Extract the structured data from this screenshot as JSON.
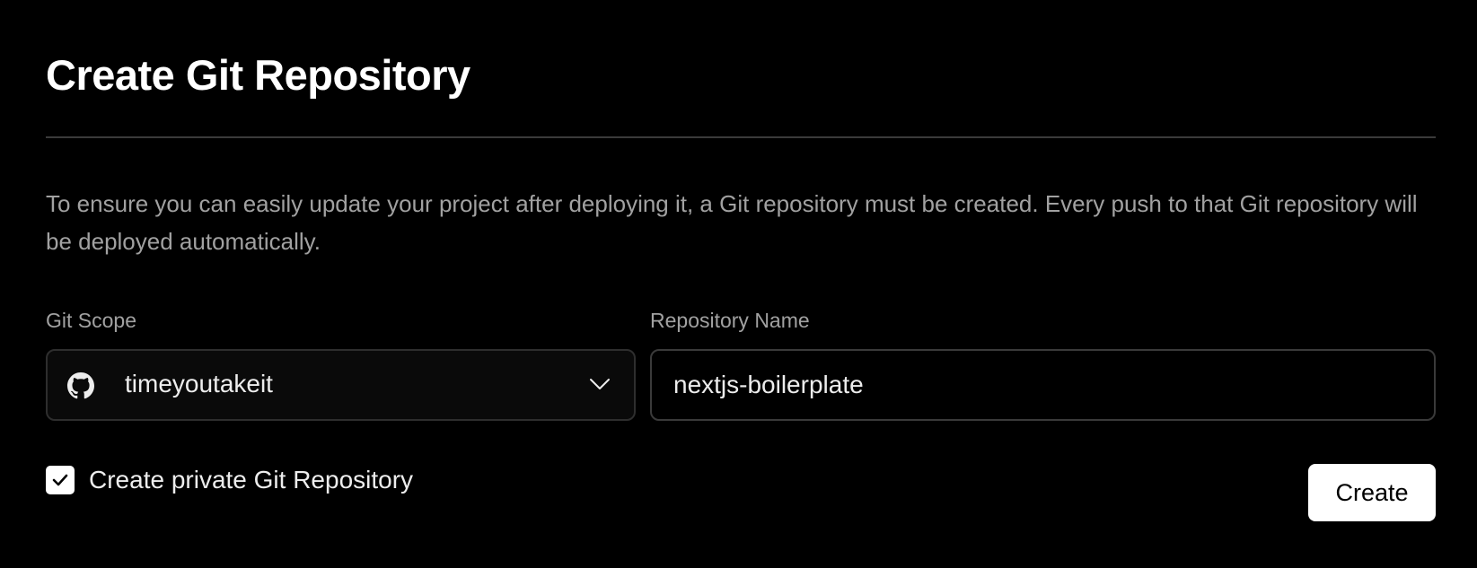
{
  "title": "Create Git Repository",
  "description": "To ensure you can easily update your project after deploying it, a Git repository must be created. Every push to that Git repository will be deployed automatically.",
  "git_scope": {
    "label": "Git Scope",
    "value": "timeyoutakeit",
    "icon": "github-icon",
    "dropdown_icon": "chevron-down-icon"
  },
  "repository_name": {
    "label": "Repository Name",
    "value": "nextjs-boilerplate"
  },
  "private_option": {
    "label": "Create private Git Repository",
    "checked": true
  },
  "create_button": {
    "label": "Create"
  },
  "colors": {
    "background": "#000000",
    "text_primary": "#ededed",
    "text_secondary": "#a1a1a1",
    "button_bg": "#ffffff",
    "button_text": "#000000",
    "border": "#3a3a3a"
  }
}
